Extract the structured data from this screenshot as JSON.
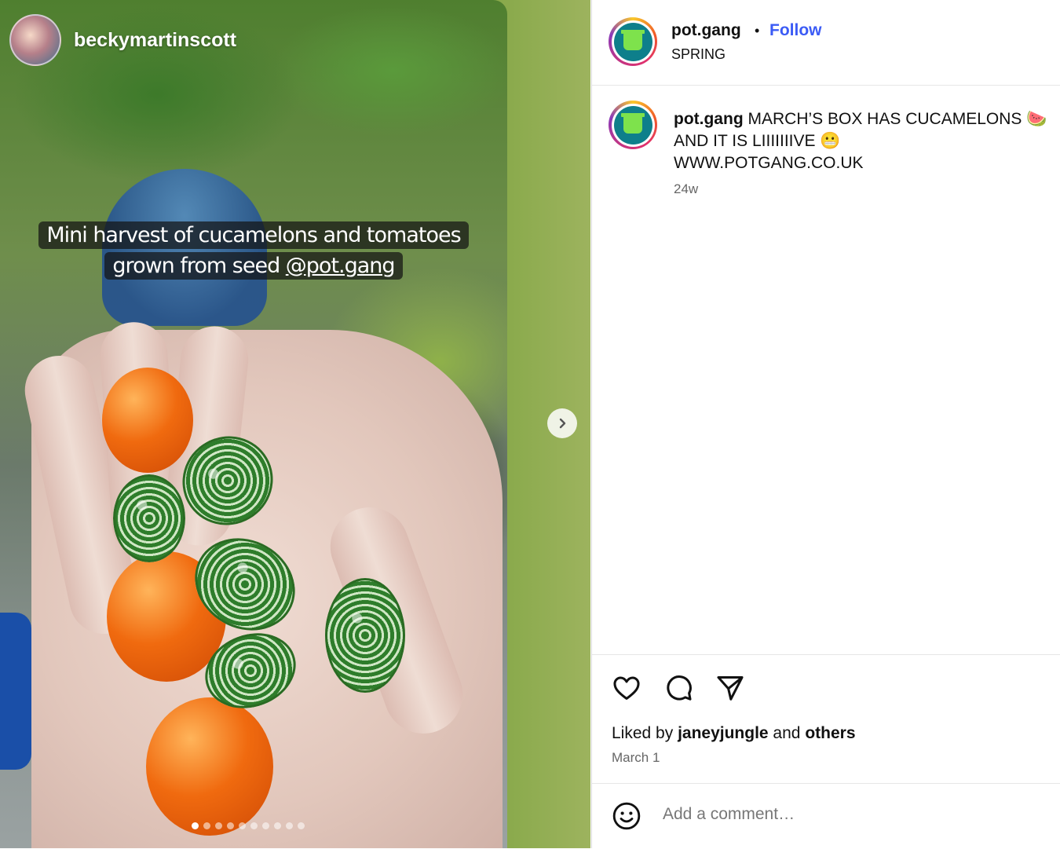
{
  "media": {
    "author": "beckymartinscott",
    "caption_line1": "Mini harvest of cucamelons and tomatoes",
    "caption_line2_prefix": "grown from seed ",
    "caption_mention": "@pot.gang",
    "slide_count": 10,
    "active_slide": 1
  },
  "header": {
    "username": "pot.gang",
    "separator": "•",
    "follow_label": "Follow",
    "subtitle": "SPRING"
  },
  "post": {
    "username": "pot.gang",
    "text_line1": "MARCH’S BOX HAS CUCAMELONS 🍉",
    "text_line2": "AND IT IS LIIIIIIIVE 😬",
    "text_line3": "WWW.POTGANG.CO.UK",
    "age": "24w"
  },
  "engagement": {
    "liked_by_prefix": "Liked by ",
    "liked_user": "janeyjungle",
    "and": " and ",
    "others": "others",
    "date": "March 1"
  },
  "comment": {
    "placeholder": "Add a comment…"
  },
  "colors": {
    "follow": "#3b5bf5",
    "logo_bg": "#0e7f8b",
    "logo_pot": "#7ee24c"
  }
}
